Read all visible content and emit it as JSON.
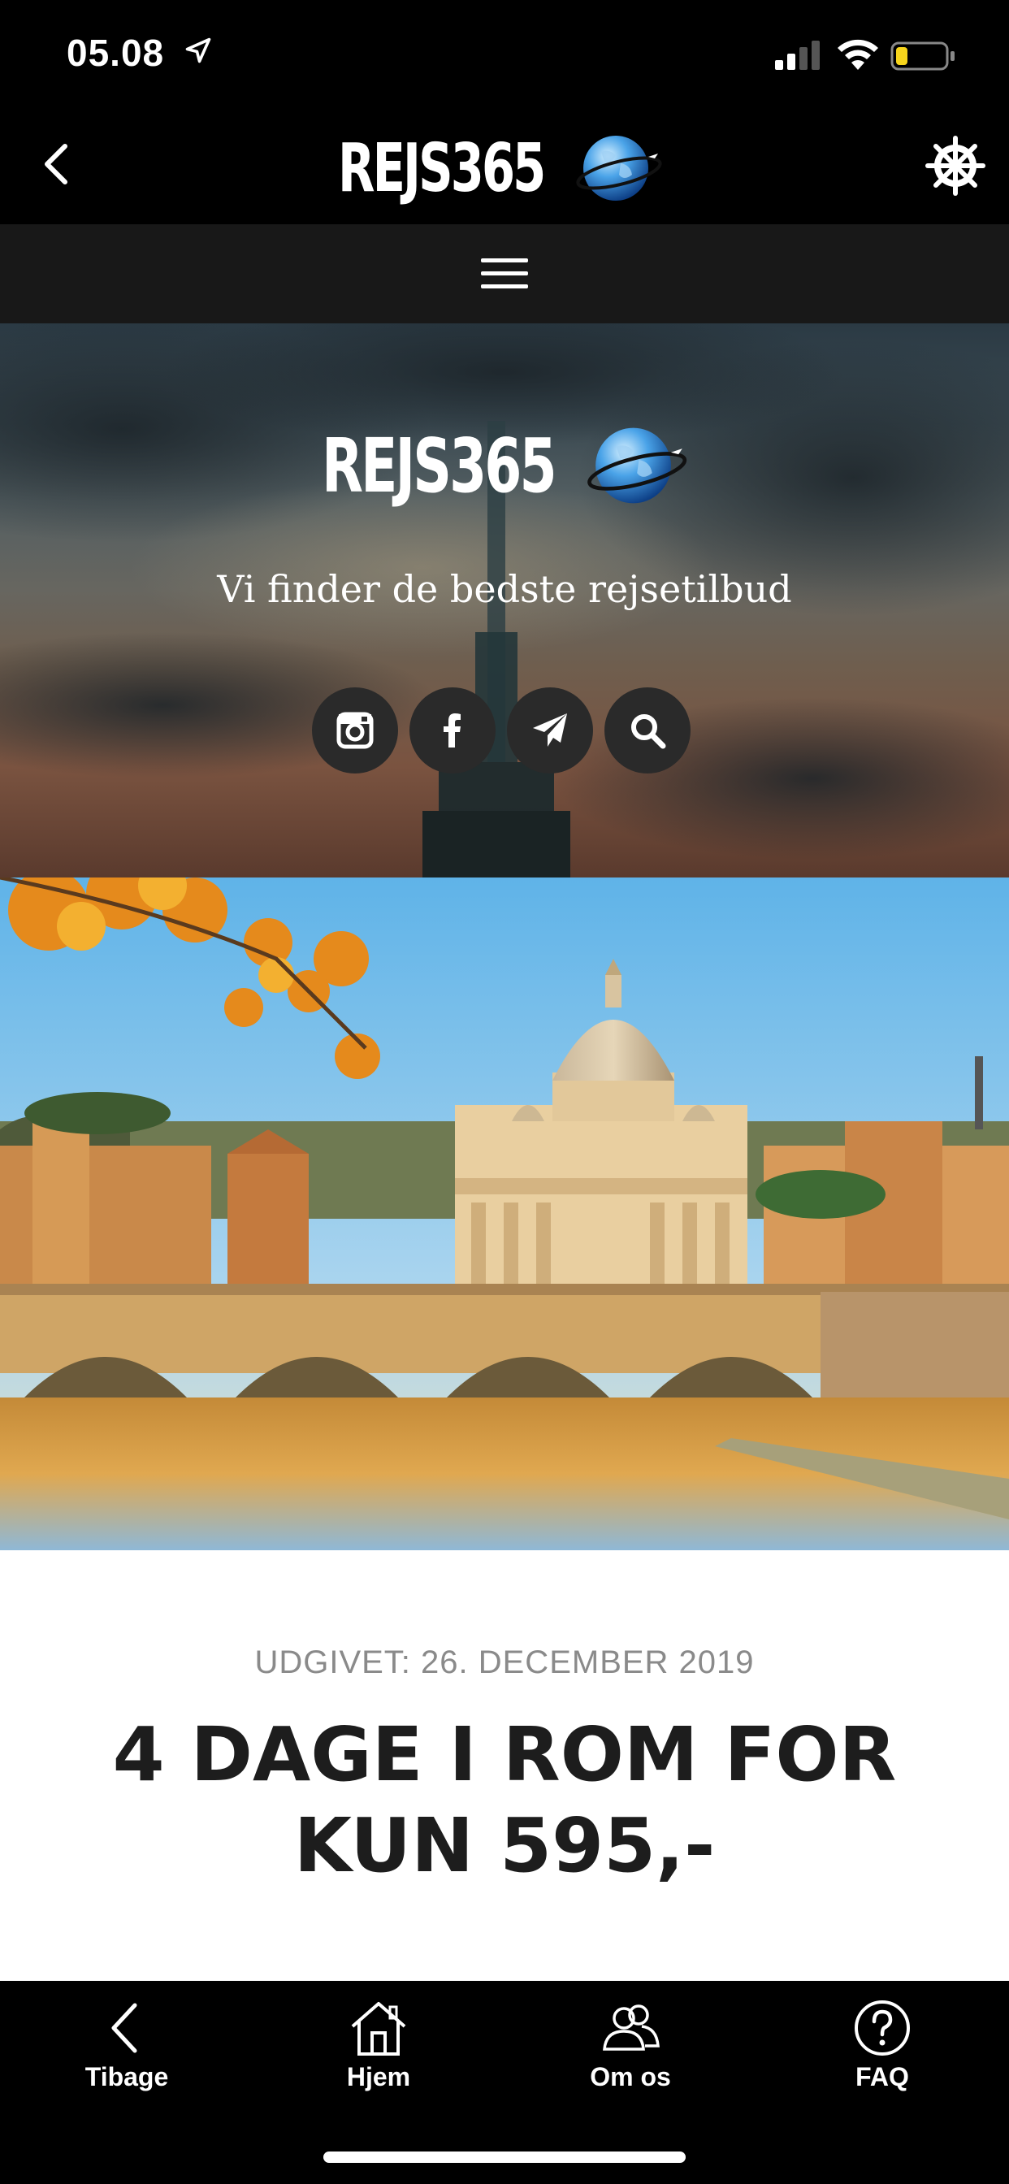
{
  "status_bar": {
    "time": "05.08",
    "location_icon": "location-arrow-icon",
    "signal_icon": "cellular-signal-icon",
    "wifi_icon": "wifi-icon",
    "battery_icon": "battery-low-icon",
    "battery_color": "#f7d51c"
  },
  "nav": {
    "back_icon": "chevron-left-icon",
    "logo_text": "REJS365",
    "logo_icon": "globe-airplane-icon",
    "settings_icon": "ship-wheel-icon"
  },
  "menu": {
    "icon": "hamburger-menu-icon"
  },
  "hero": {
    "logo_text": "REJS365",
    "tagline": "Vi finder de bedste rejsetilbud",
    "social": [
      {
        "name": "instagram",
        "icon": "instagram-icon"
      },
      {
        "name": "facebook",
        "icon": "facebook-icon"
      },
      {
        "name": "telegram",
        "icon": "paper-plane-icon"
      },
      {
        "name": "search",
        "icon": "search-icon"
      }
    ]
  },
  "article": {
    "published": "UDGIVET: 26. DECEMBER 2019",
    "title": "4 DAGE I ROM FOR KUN 595,-"
  },
  "tab_bar": {
    "items": [
      {
        "label": "Tibage",
        "icon": "chevron-left-icon"
      },
      {
        "label": "Hjem",
        "icon": "home-icon"
      },
      {
        "label": "Om os",
        "icon": "people-icon"
      },
      {
        "label": "FAQ",
        "icon": "question-circle-icon"
      }
    ]
  },
  "colors": {
    "background": "#000000",
    "menu_bar": "#181818",
    "article_bg": "#ffffff",
    "title_text": "#1d1d1d",
    "date_text": "#8a8a8a"
  }
}
